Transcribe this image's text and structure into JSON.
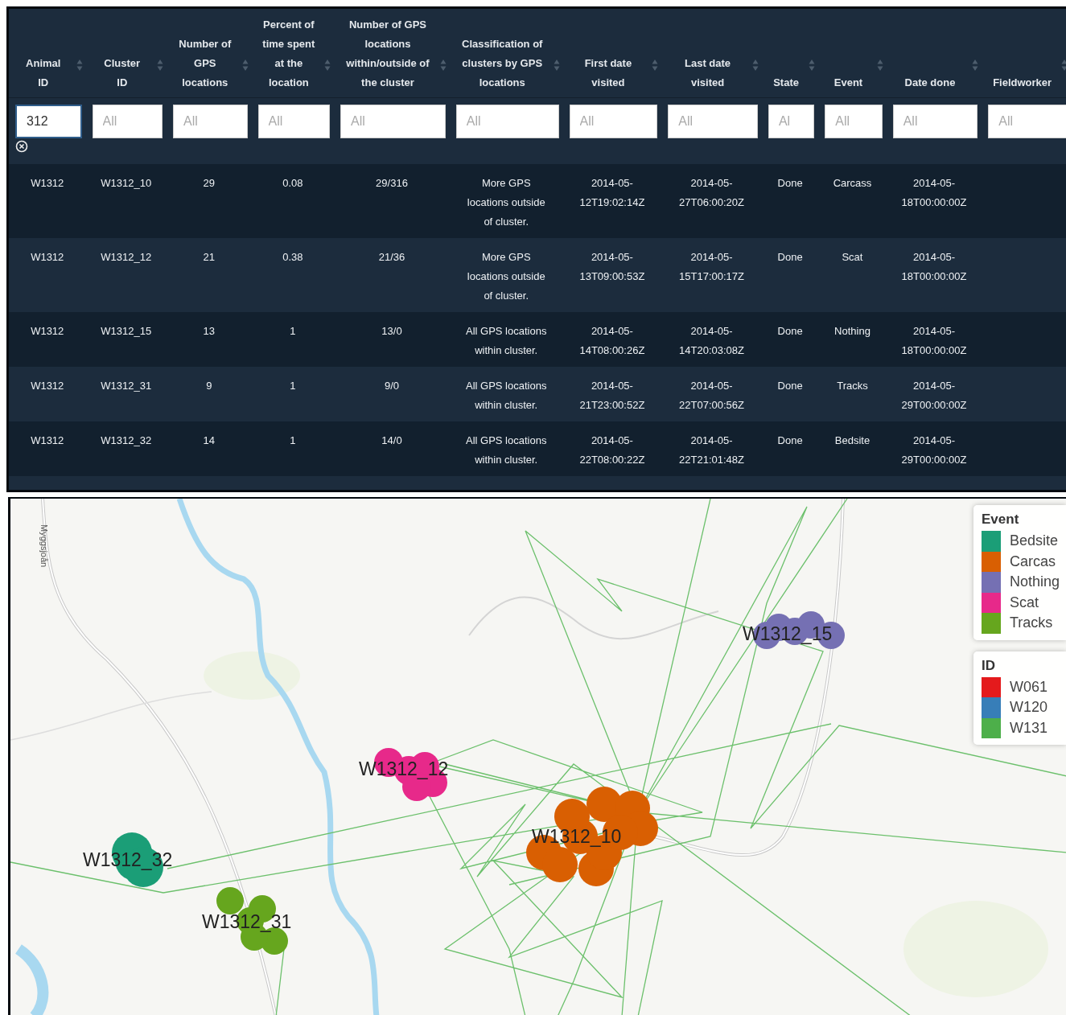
{
  "table": {
    "columns": [
      {
        "label": "Animal ID",
        "filter": {
          "value": "312"
        }
      },
      {
        "label": "Cluster ID",
        "filter": {
          "placeholder": "All"
        }
      },
      {
        "label": "Number of GPS locations",
        "filter": {
          "placeholder": "All"
        }
      },
      {
        "label": "Percent of time spent at the location",
        "filter": {
          "placeholder": "All"
        }
      },
      {
        "label": "Number of GPS locations within/outside of the cluster",
        "filter": {
          "placeholder": "All"
        }
      },
      {
        "label": "Classification of clusters by GPS locations",
        "filter": {
          "placeholder": "All"
        }
      },
      {
        "label": "First date visited",
        "filter": {
          "placeholder": "All"
        }
      },
      {
        "label": "Last date visited",
        "filter": {
          "placeholder": "All"
        }
      },
      {
        "label": "State",
        "filter": {
          "placeholder": "Al"
        }
      },
      {
        "label": "Event",
        "filter": {
          "placeholder": "All"
        }
      },
      {
        "label": "Date done",
        "filter": {
          "placeholder": "All"
        }
      },
      {
        "label": "Fieldworker",
        "filter": {
          "placeholder": "All"
        }
      }
    ],
    "rows": [
      [
        "W1312",
        "W1312_10",
        "29",
        "0.08",
        "29/316",
        "More GPS locations outside of cluster.",
        "2014-05-12T19:02:14Z",
        "2014-05-27T06:00:20Z",
        "Done",
        "Carcass",
        "2014-05-18T00:00:00Z"
      ],
      [
        "W1312",
        "W1312_12",
        "21",
        "0.38",
        "21/36",
        "More GPS locations outside of cluster.",
        "2014-05-13T09:00:53Z",
        "2014-05-15T17:00:17Z",
        "Done",
        "Scat",
        "2014-05-18T00:00:00Z"
      ],
      [
        "W1312",
        "W1312_15",
        "13",
        "1",
        "13/0",
        "All GPS locations within cluster.",
        "2014-05-14T08:00:26Z",
        "2014-05-14T20:03:08Z",
        "Done",
        "Nothing",
        "2014-05-18T00:00:00Z"
      ],
      [
        "W1312",
        "W1312_31",
        "9",
        "1",
        "9/0",
        "All GPS locations within cluster.",
        "2014-05-21T23:00:52Z",
        "2014-05-22T07:00:56Z",
        "Done",
        "Tracks",
        "2014-05-29T00:00:00Z"
      ],
      [
        "W1312",
        "W1312_32",
        "14",
        "1",
        "14/0",
        "All GPS locations within cluster.",
        "2014-05-22T08:00:22Z",
        "2014-05-22T21:01:48Z",
        "Done",
        "Bedsite",
        "2014-05-29T00:00:00Z"
      ]
    ]
  },
  "map": {
    "place_label": "Myggsjoån",
    "clusters": [
      {
        "label": "W1312_10",
        "color": "#d95f02"
      },
      {
        "label": "W1312_12",
        "color": "#e7298a"
      },
      {
        "label": "W1312_15",
        "color": "#7570b3"
      },
      {
        "label": "W1312_31",
        "color": "#66a61e"
      },
      {
        "label": "W1312_32",
        "color": "#1b9e77"
      }
    ],
    "legends": [
      {
        "title": "Event",
        "items": [
          {
            "label": "Bedsite",
            "color": "#1b9e77"
          },
          {
            "label": "Carcas",
            "color": "#d95f02"
          },
          {
            "label": "Nothing",
            "color": "#7570b3"
          },
          {
            "label": "Scat",
            "color": "#e7298a"
          },
          {
            "label": "Tracks",
            "color": "#66a61e"
          }
        ]
      },
      {
        "title": "ID",
        "items": [
          {
            "label": "W061",
            "color": "#e41a1c"
          },
          {
            "label": "W120",
            "color": "#377eb8"
          },
          {
            "label": "W131",
            "color": "#4daf4a"
          }
        ]
      }
    ]
  }
}
